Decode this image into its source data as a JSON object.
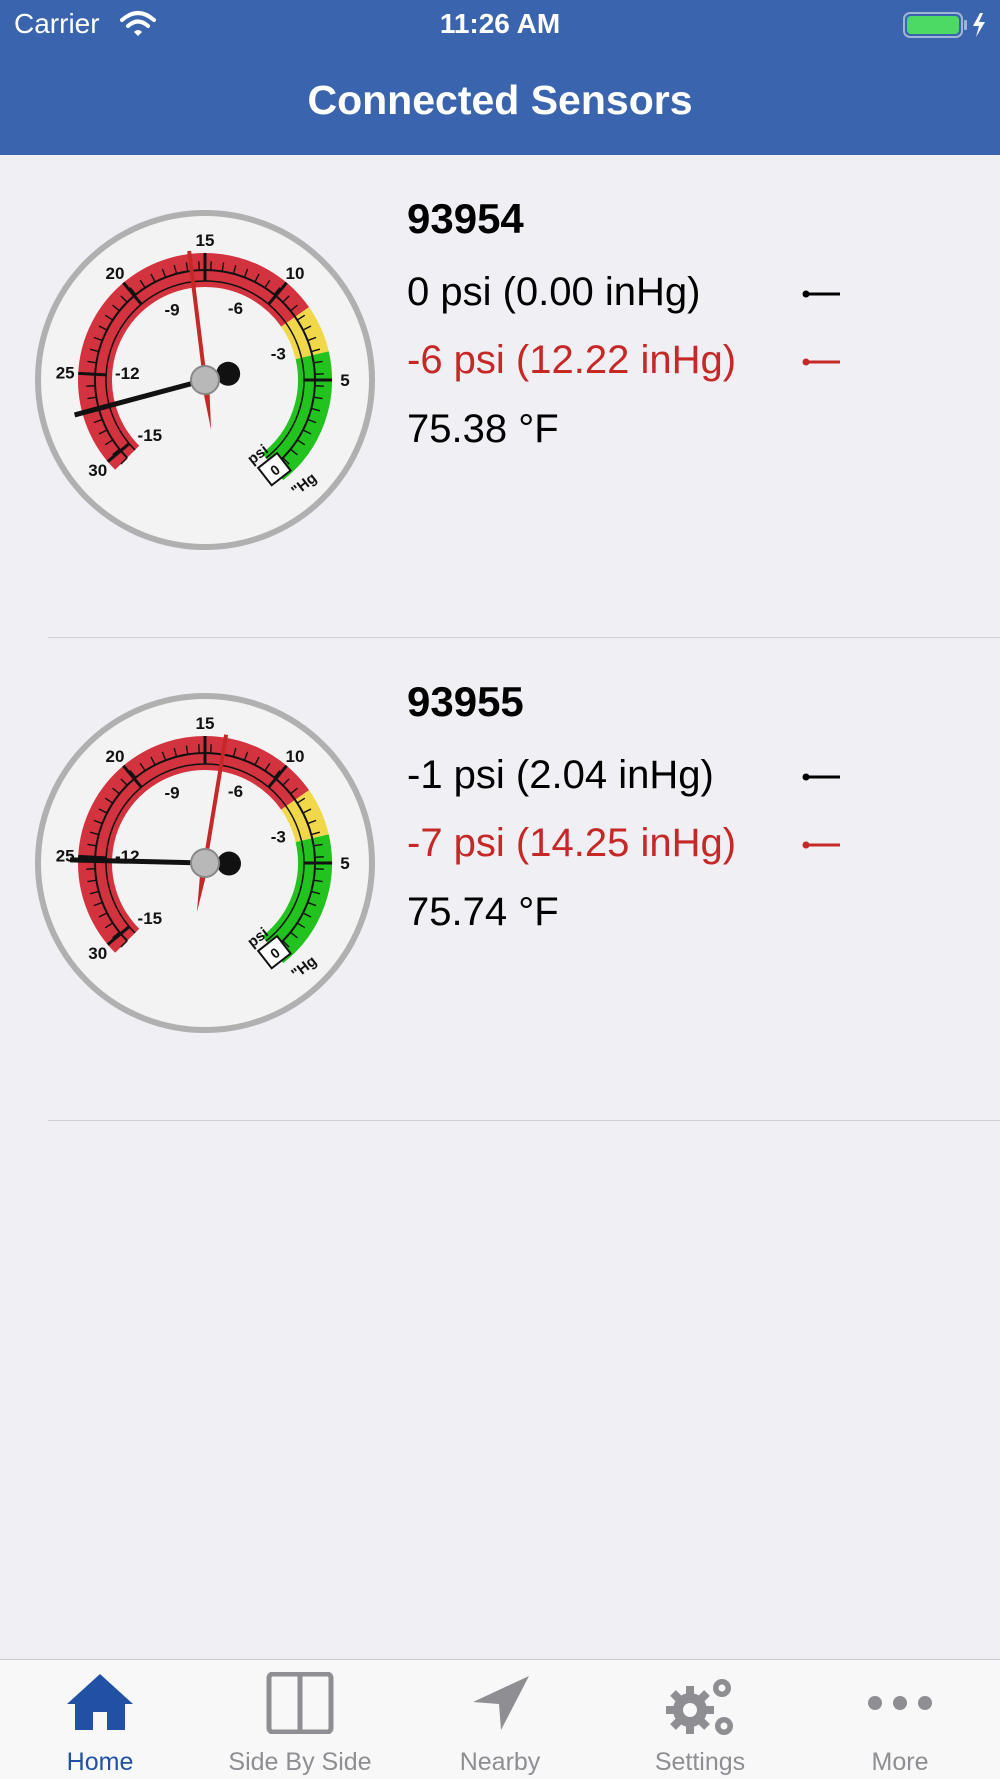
{
  "status_bar": {
    "carrier": "Carrier",
    "time": "11:26 AM"
  },
  "nav": {
    "title": "Connected Sensors"
  },
  "colors": {
    "header_bg": "#3a65ae",
    "gauge_red": "#d3323f",
    "gauge_yellow": "#f0d84a",
    "gauge_green": "#22c21f",
    "setpoint_red": "#c62828",
    "tab_active": "#2250a3",
    "tab_inactive": "#8e8e93"
  },
  "gauge_scale": {
    "outer_ticks": [
      "15",
      "20",
      "25",
      "30",
      "10",
      "5"
    ],
    "inner_ticks": [
      "-9",
      "-6",
      "-3",
      "-12",
      "-15"
    ],
    "units": [
      "psi",
      "\"Hg"
    ],
    "dial_value": "0"
  },
  "sensors": [
    {
      "id": "93954",
      "reading_psi": 0,
      "setpoint_psi": -6,
      "current": "0 psi (0.00 inHg)",
      "setpoint": "-6 psi (12.22 inHg)",
      "temperature": "75.38 °F"
    },
    {
      "id": "93955",
      "reading_psi": -1,
      "setpoint_psi": -7,
      "current": "-1 psi (2.04 inHg)",
      "setpoint": "-7 psi (14.25 inHg)",
      "temperature": "75.74 °F"
    }
  ],
  "tabs": [
    {
      "label": "Home",
      "icon": "home-icon",
      "active": true
    },
    {
      "label": "Side By Side",
      "icon": "side-by-side-icon",
      "active": false
    },
    {
      "label": "Nearby",
      "icon": "location-arrow-icon",
      "active": false
    },
    {
      "label": "Settings",
      "icon": "gears-icon",
      "active": false
    },
    {
      "label": "More",
      "icon": "more-dots-icon",
      "active": false
    }
  ]
}
